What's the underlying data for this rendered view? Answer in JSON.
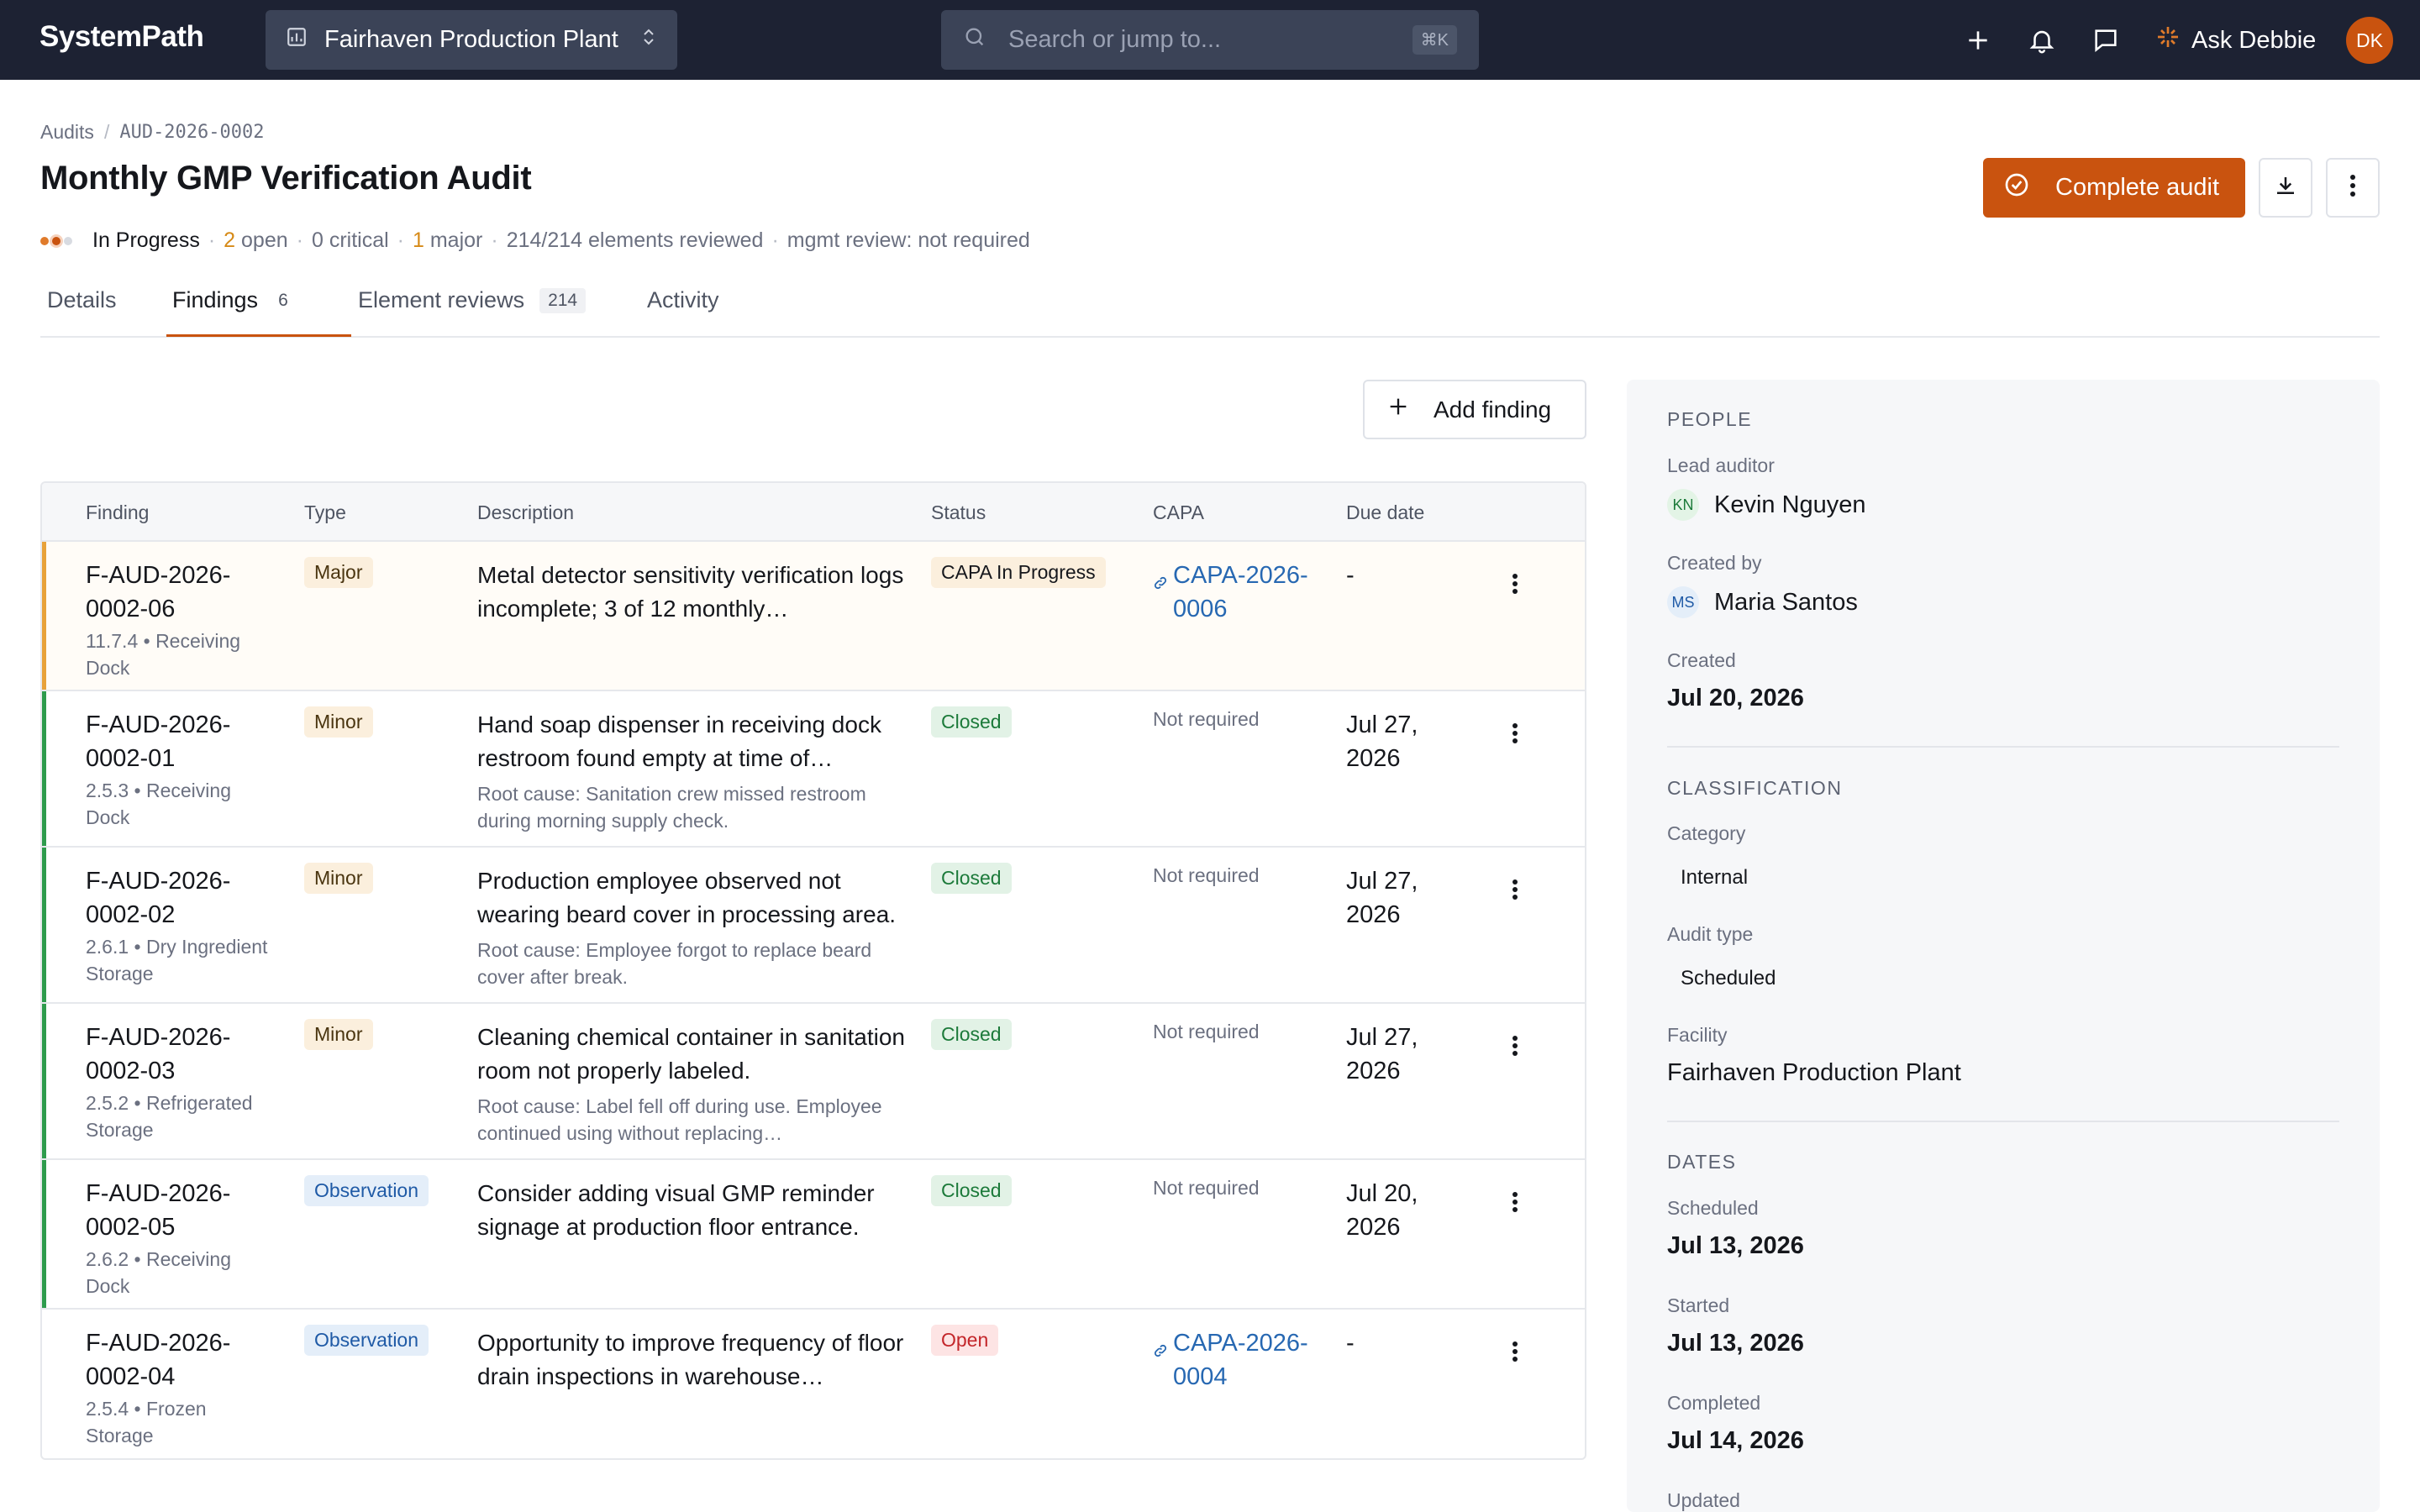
{
  "app": {
    "logo": "SystemPath",
    "facility_selector": "Fairhaven Production Plant",
    "search_placeholder": "Search or jump to...",
    "search_shortcut": "⌘K",
    "ask_label": "Ask Debbie",
    "user_initials": "DK",
    "accent_color": "#c9530f"
  },
  "breadcrumb": {
    "root": "Audits",
    "current": "AUD-2026-0002"
  },
  "page": {
    "title": "Monthly GMP Verification Audit",
    "status": "In Progress",
    "open_count": "2",
    "open_label": "open",
    "critical": "0 critical",
    "major_count": "1",
    "major_label": "major",
    "elements_reviewed": "214/214 elements reviewed",
    "mgmt_review": "mgmt review: not required",
    "complete_button": "Complete audit"
  },
  "tabs": [
    {
      "label": "Details",
      "count": ""
    },
    {
      "label": "Findings",
      "count": "6"
    },
    {
      "label": "Element reviews",
      "count": "214"
    },
    {
      "label": "Activity",
      "count": ""
    }
  ],
  "findings": {
    "add_button": "Add finding",
    "columns": [
      "Finding",
      "Type",
      "Description",
      "Status",
      "CAPA",
      "Due date"
    ],
    "rows": [
      {
        "id": "F-AUD-2026-0002-06",
        "ref": "11.7.4 • Receiving Dock",
        "type": "Major",
        "description": "Metal detector sensitivity verification logs incomplete; 3 of 12 monthly…",
        "root_cause": "",
        "status": "CAPA In Progress",
        "capa": "CAPA-2026-0006",
        "due": "-"
      },
      {
        "id": "F-AUD-2026-0002-01",
        "ref": "2.5.3 • Receiving Dock",
        "type": "Minor",
        "description": "Hand soap dispenser in receiving dock restroom found empty at time of…",
        "root_cause": "Root cause: Sanitation crew missed restroom during morning supply check.",
        "status": "Closed",
        "capa": "Not required",
        "due": "Jul 27, 2026"
      },
      {
        "id": "F-AUD-2026-0002-02",
        "ref": "2.6.1 • Dry Ingredient Storage",
        "type": "Minor",
        "description": "Production employee observed not wearing beard cover in processing area.",
        "root_cause": "Root cause: Employee forgot to replace beard cover after break.",
        "status": "Closed",
        "capa": "Not required",
        "due": "Jul 27, 2026"
      },
      {
        "id": "F-AUD-2026-0002-03",
        "ref": "2.5.2 • Refrigerated Storage",
        "type": "Minor",
        "description": "Cleaning chemical container in sanitation room not properly labeled.",
        "root_cause": "Root cause: Label fell off during use. Employee continued using without replacing…",
        "status": "Closed",
        "capa": "Not required",
        "due": "Jul 27, 2026"
      },
      {
        "id": "F-AUD-2026-0002-05",
        "ref": "2.6.2 • Receiving Dock",
        "type": "Observation",
        "description": "Consider adding visual GMP reminder signage at production floor entrance.",
        "root_cause": "",
        "status": "Closed",
        "capa": "Not required",
        "due": "Jul 20, 2026"
      },
      {
        "id": "F-AUD-2026-0002-04",
        "ref": "2.5.4 • Frozen Storage",
        "type": "Observation",
        "description": "Opportunity to improve frequency of floor drain inspections in warehouse…",
        "root_cause": "",
        "status": "Open",
        "capa": "CAPA-2026-0004",
        "due": "-"
      }
    ]
  },
  "side": {
    "people_title": "PEOPLE",
    "lead_auditor_label": "Lead auditor",
    "lead_auditor_initials": "KN",
    "lead_auditor": "Kevin Nguyen",
    "created_by_label": "Created by",
    "created_by_initials": "MS",
    "created_by": "Maria Santos",
    "created_label": "Created",
    "created": "Jul 20, 2026",
    "classification_title": "CLASSIFICATION",
    "category_label": "Category",
    "category": "Internal",
    "audit_type_label": "Audit type",
    "audit_type": "Scheduled",
    "facility_label": "Facility",
    "facility": "Fairhaven Production Plant",
    "dates_title": "DATES",
    "scheduled_label": "Scheduled",
    "scheduled": "Jul 13, 2026",
    "started_label": "Started",
    "started": "Jul 13, 2026",
    "completed_label": "Completed",
    "completed": "Jul 14, 2026",
    "updated_label": "Updated"
  }
}
